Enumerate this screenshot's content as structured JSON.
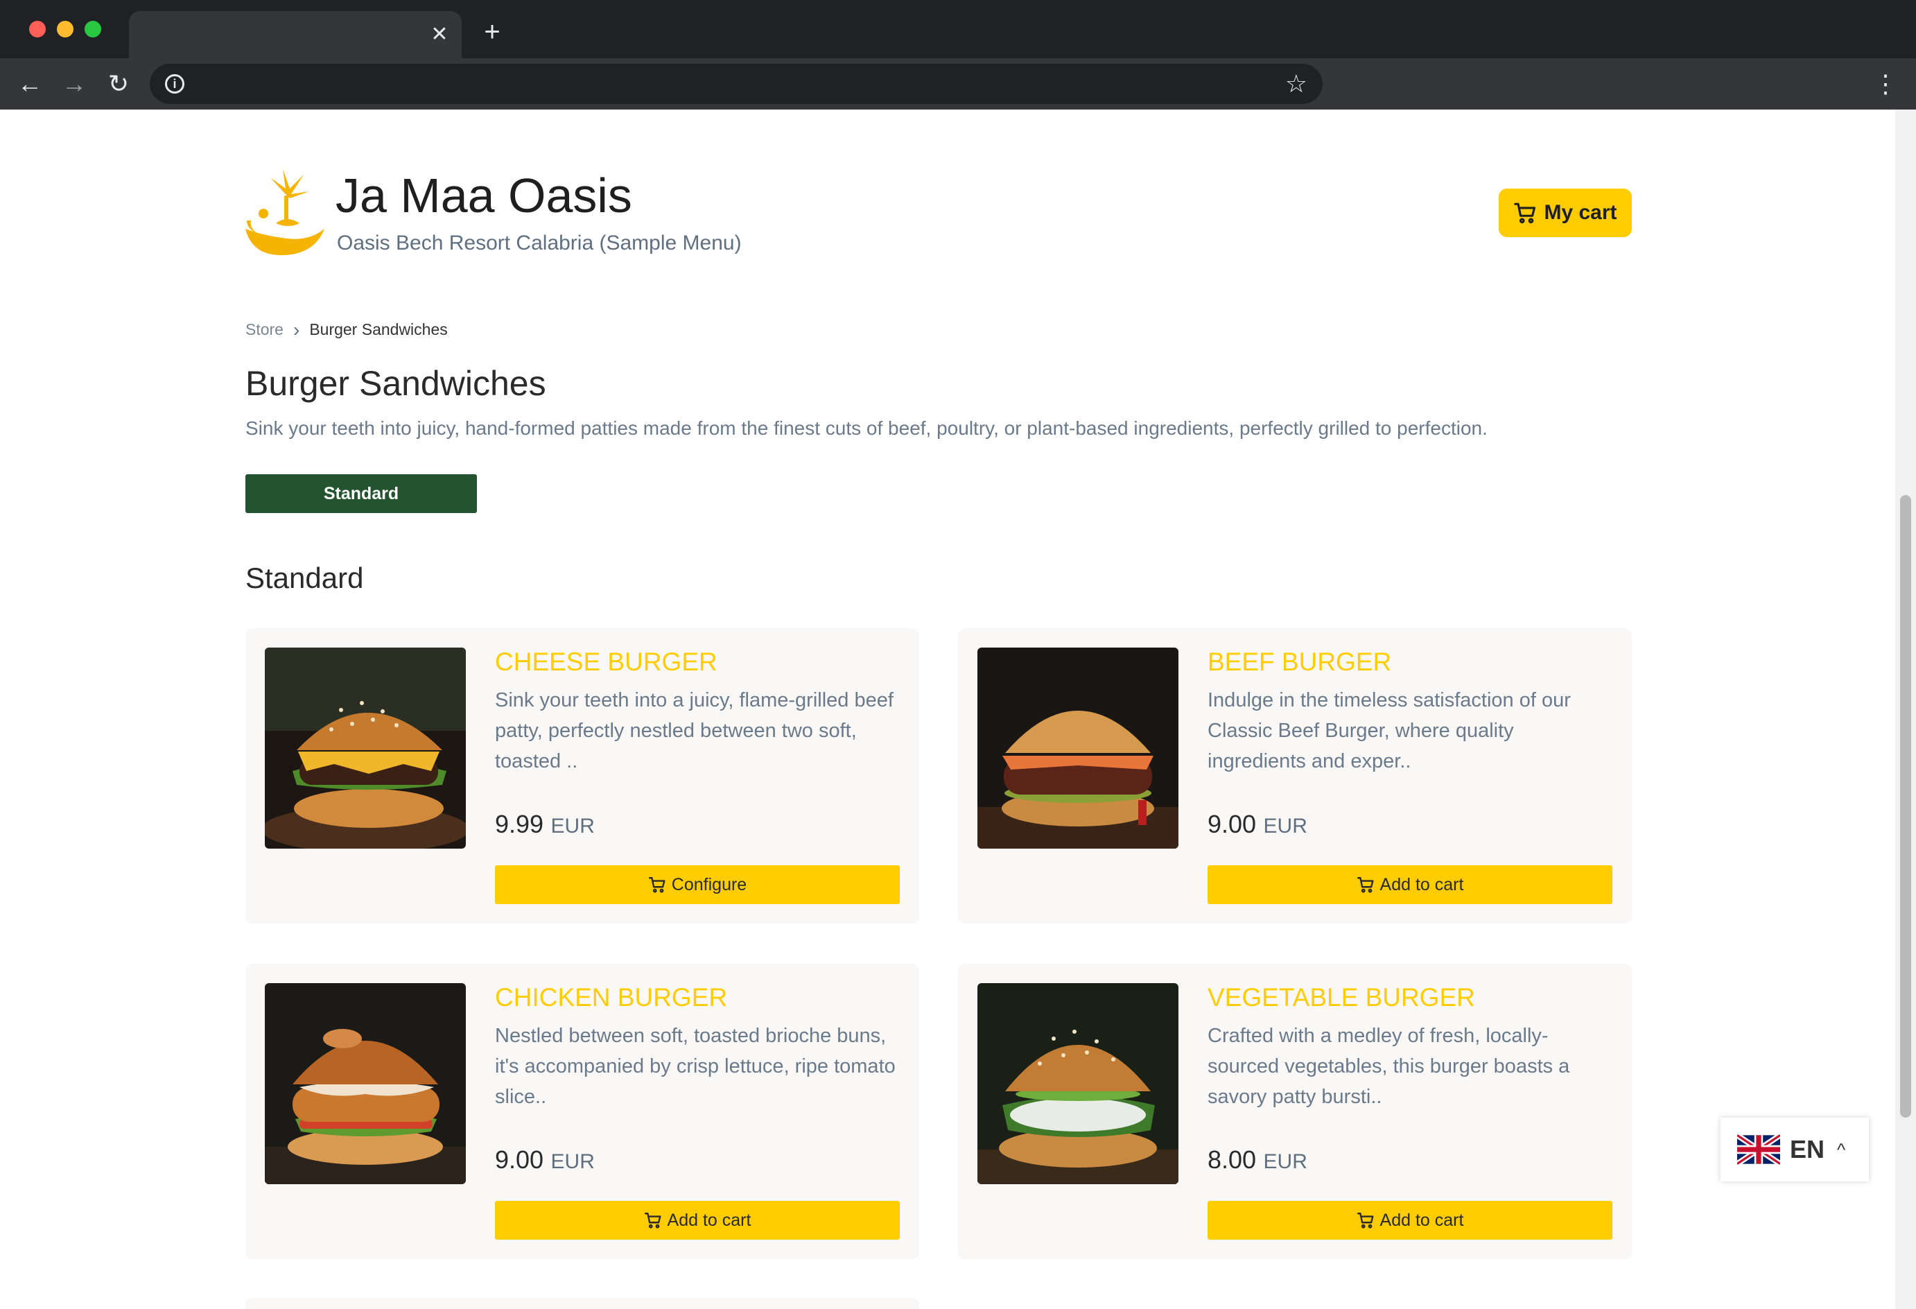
{
  "browser": {
    "tab_close": "✕",
    "new_tab": "+",
    "back": "←",
    "forward": "→",
    "reload": "↻",
    "info": "i",
    "star": "☆",
    "menu": "⋮"
  },
  "header": {
    "title": "Ja Maa Oasis",
    "subtitle": "Oasis Bech Resort Calabria (Sample Menu)",
    "cart_label": "My cart"
  },
  "breadcrumb": {
    "root": "Store",
    "separator": "›",
    "current": "Burger Sandwiches"
  },
  "category": {
    "title": "Burger Sandwiches",
    "description": "Sink your teeth into juicy, hand-formed patties made from the finest cuts of beef, poultry, or plant-based ingredients, perfectly grilled to perfection.",
    "filter_label": "Standard",
    "section_title": "Standard"
  },
  "products": [
    {
      "name": "CHEESE BURGER",
      "description": "Sink your teeth into a juicy, flame-grilled beef patty, perfectly nestled between two soft, toasted ..",
      "price": "9.99",
      "currency": "EUR",
      "button": "Configure"
    },
    {
      "name": "BEEF BURGER",
      "description": "Indulge in the timeless satisfaction of our Classic Beef Burger, where quality ingredients and exper..",
      "price": "9.00",
      "currency": "EUR",
      "button": "Add to cart"
    },
    {
      "name": "CHICKEN BURGER",
      "description": "Nestled between soft, toasted brioche buns, it's accompanied by crisp lettuce, ripe tomato slice..",
      "price": "9.00",
      "currency": "EUR",
      "button": "Add to cart"
    },
    {
      "name": "VEGETABLE BURGER",
      "description": "Crafted with a medley of fresh, locally-sourced vegetables, this burger boasts a savory patty bursti..",
      "price": "8.00",
      "currency": "EUR",
      "button": "Add to cart"
    }
  ],
  "language": {
    "code": "EN",
    "caret": "^",
    "flag_icon": "uk-flag-icon"
  },
  "colors": {
    "accent": "#ffcc00",
    "filter_button": "#24532f",
    "text_muted": "#6a7a8a"
  }
}
